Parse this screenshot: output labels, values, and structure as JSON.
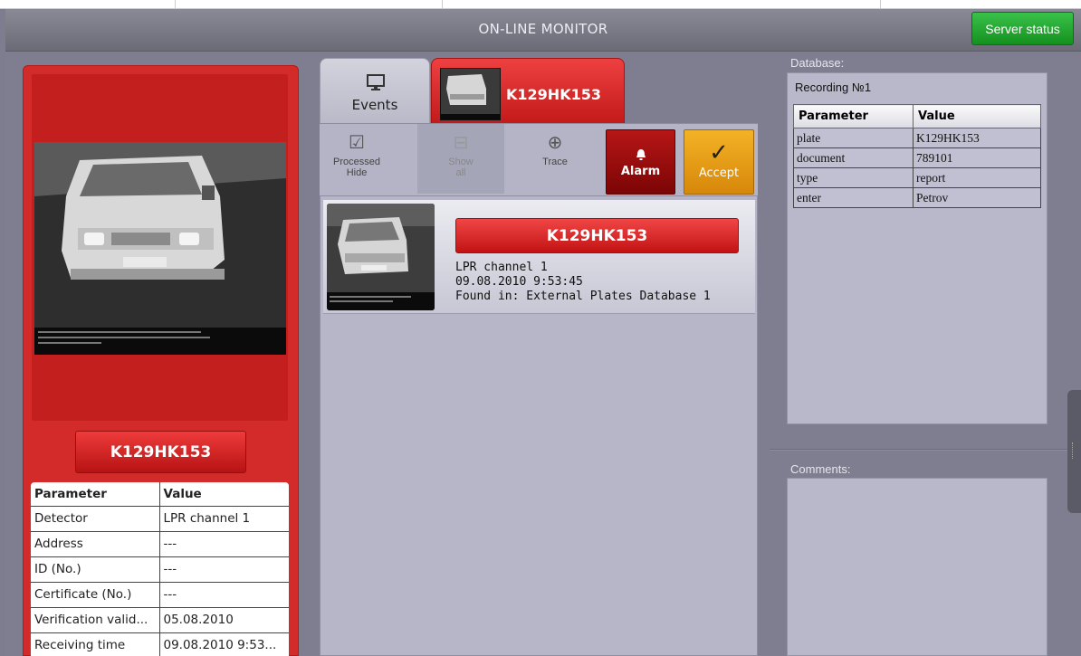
{
  "header": {
    "title": "ON-LINE MONITOR",
    "server_status_label": "Server status"
  },
  "left_panel": {
    "plate_label": "K129HK153",
    "table": {
      "headers": [
        "Parameter",
        "Value"
      ],
      "rows": [
        [
          "Detector",
          "LPR channel 1"
        ],
        [
          "Address",
          "---"
        ],
        [
          "ID (No.)",
          "---"
        ],
        [
          "Certificate (No.)",
          "---"
        ],
        [
          "Verification valid...",
          "05.08.2010"
        ],
        [
          "Receiving time",
          "09.08.2010 9:53..."
        ]
      ]
    }
  },
  "tabs": {
    "events_label": "Events",
    "plate_label": "K129HK153"
  },
  "toolbar": {
    "processed_line1": "Processed",
    "processed_line2": "Hide",
    "show_line1": "Show",
    "show_line2": "all",
    "trace_label": "Trace",
    "alarm_label": "Alarm",
    "accept_label": "Accept"
  },
  "event": {
    "plate": "K129HK153",
    "channel": "LPR channel 1",
    "datetime": "09.08.2010 9:53:45",
    "found_in": "Found in: External Plates Database 1"
  },
  "database": {
    "label": "Database:",
    "recording": "Recording №1",
    "headers": [
      "Parameter",
      "Value"
    ],
    "rows": [
      [
        "plate",
        "K129HK153"
      ],
      [
        "document",
        "789101"
      ],
      [
        "type",
        "report"
      ],
      [
        "enter",
        "Petrov"
      ]
    ]
  },
  "comments": {
    "label": "Comments:"
  },
  "colors": {
    "accent_red": "#d32a2a",
    "accept_orange": "#f0a51c",
    "server_green": "#1fa32c"
  }
}
